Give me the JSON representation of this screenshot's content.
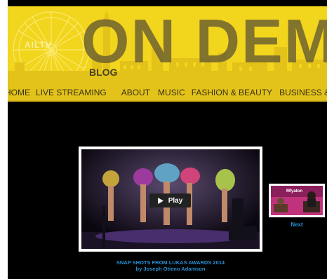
{
  "header": {
    "title": "ON DEMA",
    "logo_text": "AILTV",
    "subtitle": "BLOG"
  },
  "nav": {
    "items": [
      {
        "label": "HOME"
      },
      {
        "label": "LIVE STREAMING"
      },
      {
        "label": "ABOUT"
      },
      {
        "label": "MUSIC"
      },
      {
        "label": "FASHION & BEAUTY"
      },
      {
        "label": "BUSINESS & CURRENT"
      }
    ]
  },
  "video": {
    "play_label": "Play",
    "caption_title": "SNAP SHOTS FROM LUKAS AWARDS 2014",
    "caption_author": "by Joseph  Otieno Adamson"
  },
  "sidebar": {
    "next_label": "Next",
    "thumb_text": "Mfyaton"
  },
  "colors": {
    "header_yellow": "#f2d51d",
    "link_blue": "#2a8fd4",
    "background": "#000000"
  }
}
